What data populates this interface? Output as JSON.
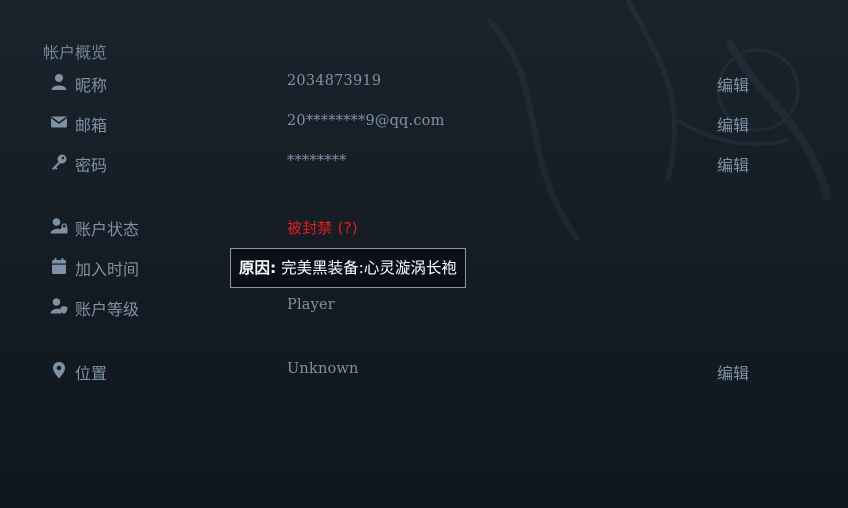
{
  "section": {
    "title": "帐户概览"
  },
  "rows": [
    {
      "icon": "user-icon",
      "label": "昵称",
      "value": "2034873919",
      "edit": "编辑"
    },
    {
      "icon": "envelope-icon",
      "label": "邮箱",
      "value": "20********9@qq.com",
      "edit": "编辑"
    },
    {
      "icon": "key-icon",
      "label": "密码",
      "value": "********",
      "edit": "编辑"
    },
    {
      "icon": "user-lock-icon",
      "label": "账户状态",
      "value": "被封禁",
      "value_suffix": "(?)",
      "value_color": "#e01e1e"
    },
    {
      "icon": "calendar-icon",
      "label": "加入时间",
      "value": ""
    },
    {
      "icon": "user-shield-icon",
      "label": "账户等级",
      "value": "Player"
    },
    {
      "icon": "map-marker-icon",
      "label": "位置",
      "value": "Unknown",
      "edit": "编辑"
    }
  ],
  "tooltip": {
    "prefix": "原因:",
    "text": "完美黑装备:心灵漩涡长袍"
  }
}
